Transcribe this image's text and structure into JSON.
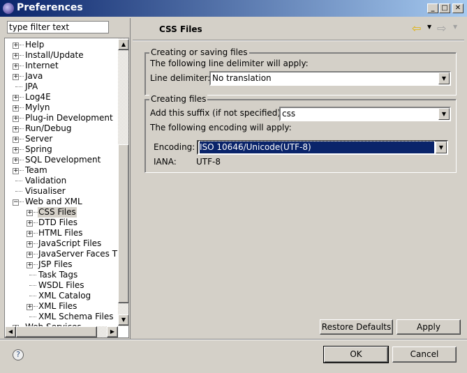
{
  "window": {
    "title": "Preferences",
    "minimize": "_",
    "maximize": "□",
    "close": "✕"
  },
  "filter": {
    "value": "type filter text"
  },
  "tree": [
    {
      "label": "Help",
      "level": 0,
      "expander": "plus"
    },
    {
      "label": "Install/Update",
      "level": 0,
      "expander": "plus"
    },
    {
      "label": "Internet",
      "level": 0,
      "expander": "plus"
    },
    {
      "label": "Java",
      "level": 0,
      "expander": "plus"
    },
    {
      "label": "JPA",
      "level": 0,
      "expander": "none"
    },
    {
      "label": "Log4E",
      "level": 0,
      "expander": "plus"
    },
    {
      "label": "Mylyn",
      "level": 0,
      "expander": "plus"
    },
    {
      "label": "Plug-in Development",
      "level": 0,
      "expander": "plus"
    },
    {
      "label": "Run/Debug",
      "level": 0,
      "expander": "plus"
    },
    {
      "label": "Server",
      "level": 0,
      "expander": "plus"
    },
    {
      "label": "Spring",
      "level": 0,
      "expander": "plus"
    },
    {
      "label": "SQL Development",
      "level": 0,
      "expander": "plus"
    },
    {
      "label": "Team",
      "level": 0,
      "expander": "plus"
    },
    {
      "label": "Validation",
      "level": 0,
      "expander": "none"
    },
    {
      "label": "Visualiser",
      "level": 0,
      "expander": "none"
    },
    {
      "label": "Web and XML",
      "level": 0,
      "expander": "minus"
    },
    {
      "label": "CSS Files",
      "level": 1,
      "expander": "plus",
      "selected": true
    },
    {
      "label": "DTD Files",
      "level": 1,
      "expander": "plus"
    },
    {
      "label": "HTML Files",
      "level": 1,
      "expander": "plus"
    },
    {
      "label": "JavaScript Files",
      "level": 1,
      "expander": "plus"
    },
    {
      "label": "JavaServer Faces T",
      "level": 1,
      "expander": "plus"
    },
    {
      "label": "JSP Files",
      "level": 1,
      "expander": "plus"
    },
    {
      "label": "Task Tags",
      "level": 1,
      "expander": "none"
    },
    {
      "label": "WSDL Files",
      "level": 1,
      "expander": "none"
    },
    {
      "label": "XML Catalog",
      "level": 1,
      "expander": "none"
    },
    {
      "label": "XML Files",
      "level": 1,
      "expander": "plus"
    },
    {
      "label": "XML Schema Files",
      "level": 1,
      "expander": "none"
    },
    {
      "label": "Web Services",
      "level": 0,
      "expander": "plus"
    }
  ],
  "page": {
    "title": "CSS Files",
    "back_icon": "arrow-left",
    "forward_icon": "arrow-right"
  },
  "group1": {
    "title": "Creating or saving files",
    "desc": "The following line delimiter will apply:",
    "label": "Line delimiter:",
    "value": "No translation"
  },
  "group2": {
    "title": "Creating files",
    "suffix_label": "Add this suffix (if not specified):",
    "suffix_value": "css",
    "desc": "The following encoding will apply:",
    "encoding_label": "Encoding:",
    "encoding_value": "ISO 10646/Unicode(UTF-8)",
    "iana_label": "IANA:",
    "iana_value": "UTF-8"
  },
  "buttons": {
    "restore": "Restore Defaults",
    "apply": "Apply",
    "ok": "OK",
    "cancel": "Cancel",
    "help": "?"
  }
}
